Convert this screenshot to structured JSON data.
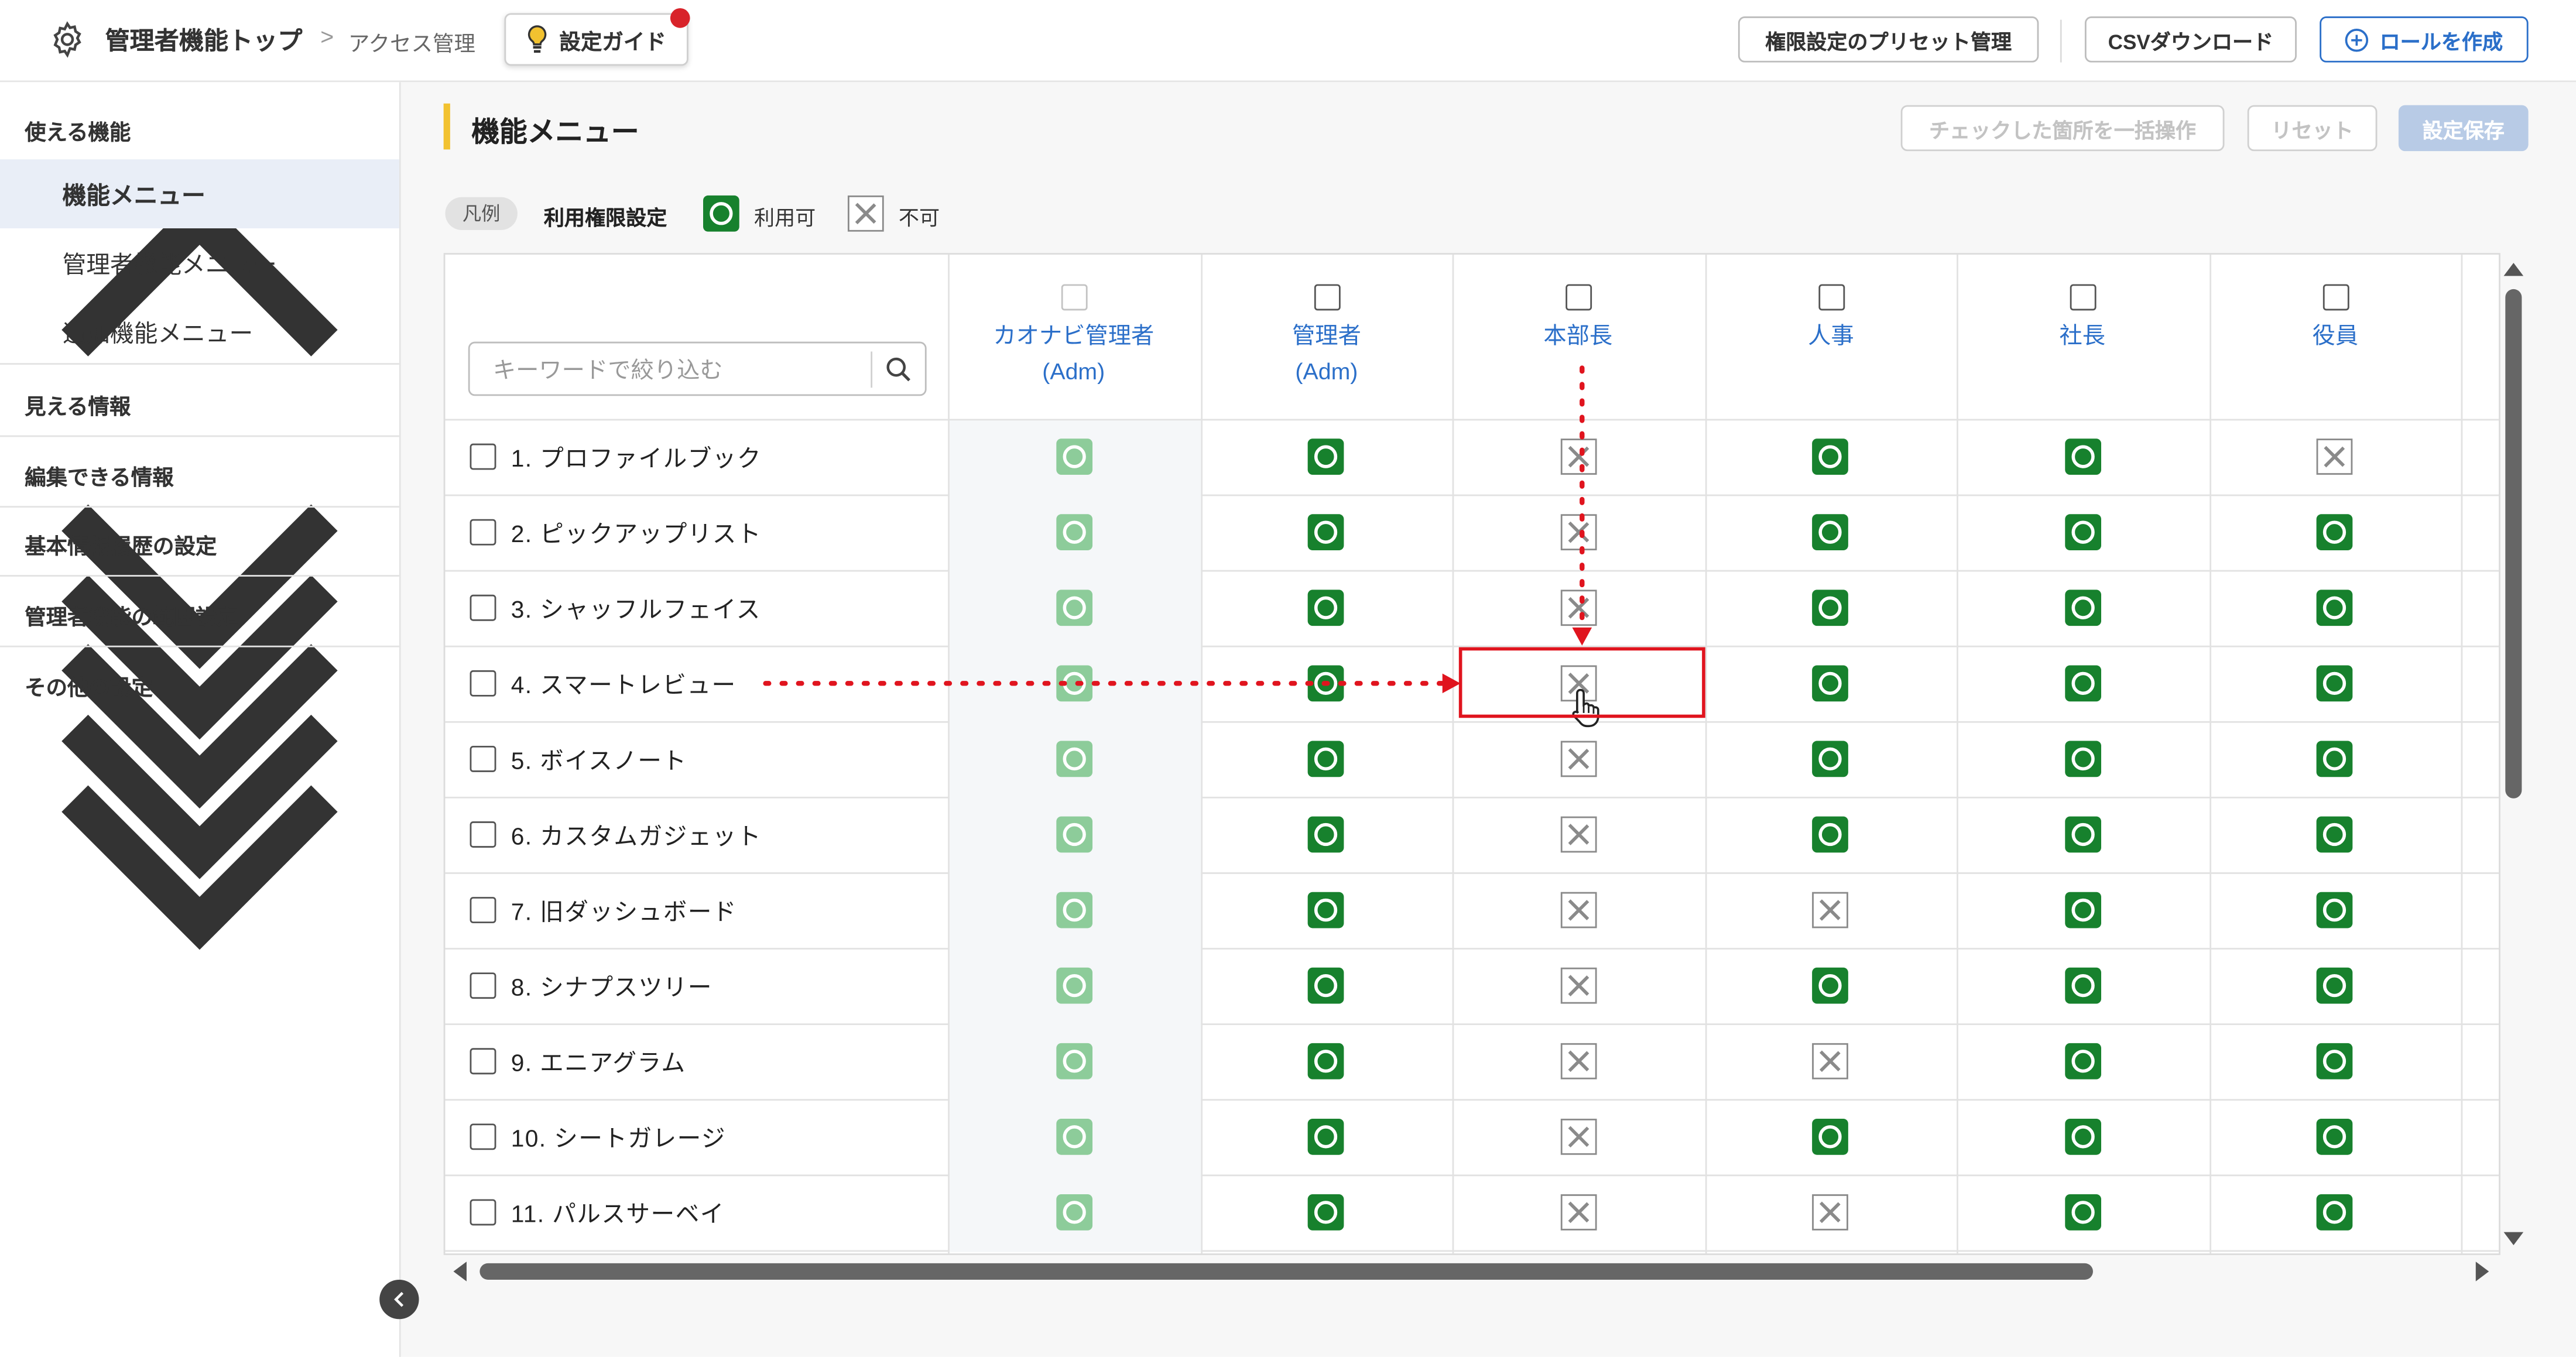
{
  "header": {
    "breadcrumb_main": "管理者機能トップ",
    "breadcrumb_sep": ">",
    "breadcrumb_sub": "アクセス管理",
    "guide_label": "設定ガイド",
    "preset_label": "権限設定のプリセット管理",
    "csv_label": "CSVダウンロード",
    "create_role_label": "ロールを作成"
  },
  "sidebar": {
    "sections": [
      {
        "label": "使える機能",
        "expanded": true
      },
      {
        "label": "見える情報",
        "expanded": false
      },
      {
        "label": "編集できる情報",
        "expanded": false
      },
      {
        "label": "基本情報履歴の設定",
        "expanded": false
      },
      {
        "label": "管理者機能の範囲設定",
        "expanded": false
      },
      {
        "label": "その他の設定",
        "expanded": false
      }
    ],
    "items": [
      {
        "label": "機能メニュー",
        "active": true
      },
      {
        "label": "管理者機能メニュー",
        "active": false
      },
      {
        "label": "追加機能メニュー",
        "active": false
      }
    ]
  },
  "main": {
    "title": "機能メニュー",
    "bulk_label": "チェックした箇所を一括操作",
    "reset_label": "リセット",
    "save_label": "設定保存",
    "legend": {
      "badge": "凡例",
      "title": "利用権限設定",
      "allowed": "利用可",
      "denied": "不可"
    },
    "search_placeholder": "キーワードで絞り込む"
  },
  "table": {
    "columns": [
      {
        "name": "カオナビ管理者",
        "sub": "(Adm)",
        "locked": true
      },
      {
        "name": "管理者",
        "sub": "(Adm)",
        "locked": false
      },
      {
        "name": "本部長",
        "sub": "",
        "locked": false
      },
      {
        "name": "人事",
        "sub": "",
        "locked": false
      },
      {
        "name": "社長",
        "sub": "",
        "locked": false
      },
      {
        "name": "役員",
        "sub": "",
        "locked": false
      }
    ],
    "rows": [
      {
        "label": "1. プロファイルブック",
        "perms": [
          "ok",
          "ok",
          "ng",
          "ok",
          "ok",
          "ng"
        ]
      },
      {
        "label": "2. ピックアップリスト",
        "perms": [
          "ok",
          "ok",
          "ng",
          "ok",
          "ok",
          "ok"
        ]
      },
      {
        "label": "3. シャッフルフェイス",
        "perms": [
          "ok",
          "ok",
          "ng",
          "ok",
          "ok",
          "ok"
        ]
      },
      {
        "label": "4. スマートレビュー",
        "perms": [
          "ok",
          "ok",
          "ng",
          "ok",
          "ok",
          "ok"
        ]
      },
      {
        "label": "5. ボイスノート",
        "perms": [
          "ok",
          "ok",
          "ng",
          "ok",
          "ok",
          "ok"
        ]
      },
      {
        "label": "6. カスタムガジェット",
        "perms": [
          "ok",
          "ok",
          "ng",
          "ok",
          "ok",
          "ok"
        ]
      },
      {
        "label": "7. 旧ダッシュボード",
        "perms": [
          "ok",
          "ok",
          "ng",
          "ng",
          "ok",
          "ok"
        ]
      },
      {
        "label": "8. シナプスツリー",
        "perms": [
          "ok",
          "ok",
          "ng",
          "ok",
          "ok",
          "ok"
        ]
      },
      {
        "label": "9. エニアグラム",
        "perms": [
          "ok",
          "ok",
          "ng",
          "ng",
          "ok",
          "ok"
        ]
      },
      {
        "label": "10. シートガレージ",
        "perms": [
          "ok",
          "ok",
          "ng",
          "ok",
          "ok",
          "ok"
        ]
      },
      {
        "label": "11. パルスサーベイ",
        "perms": [
          "ok",
          "ok",
          "ng",
          "ng",
          "ok",
          "ok"
        ]
      }
    ]
  },
  "colors": {
    "brand": "#2b6fc9",
    "allowed": "#17812d",
    "allowed_locked": "#8dcc9a",
    "highlight": "#e0141e",
    "title_accent": "#f2c230"
  }
}
